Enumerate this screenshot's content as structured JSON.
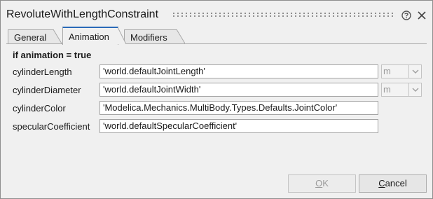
{
  "window": {
    "title": "RevoluteWithLengthConstraint",
    "help_icon": "help-icon",
    "close_icon": "close-icon"
  },
  "tabs": [
    {
      "label": "General",
      "active": false
    },
    {
      "label": "Animation",
      "active": true
    },
    {
      "label": "Modifiers",
      "active": false
    }
  ],
  "section": {
    "heading": "if animation = true"
  },
  "params": [
    {
      "label": "cylinderLength",
      "value": "'world.defaultJointLength'",
      "unit": "m"
    },
    {
      "label": "cylinderDiameter",
      "value": "'world.defaultJointWidth'",
      "unit": "m"
    },
    {
      "label": "cylinderColor",
      "value": "'Modelica.Mechanics.MultiBody.Types.Defaults.JointColor'"
    },
    {
      "label": "specularCoefficient",
      "value": "'world.defaultSpecularCoefficient'"
    }
  ],
  "buttons": {
    "ok_label": "OK",
    "ok_mnemonic": "O",
    "ok_rest": "K",
    "ok_enabled": false,
    "cancel_label": "Cancel",
    "cancel_mnemonic": "C",
    "cancel_rest": "ancel"
  },
  "colors": {
    "active_tab_accent": "#2a6ab8",
    "dialog_background": "#f0f0f0"
  }
}
